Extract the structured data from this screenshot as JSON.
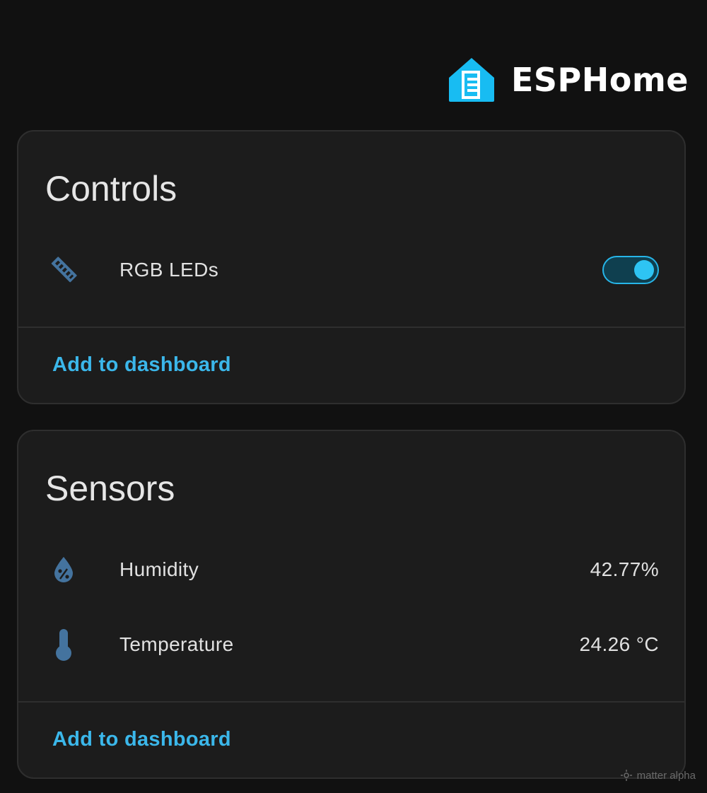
{
  "header": {
    "brand_name": "ESPHome",
    "logo_icon": "esphome-house-logo",
    "logo_color": "#18bcf2"
  },
  "controls": {
    "title": "Controls",
    "items": [
      {
        "icon": "led-strip-icon",
        "label": "RGB LEDs",
        "toggle_on": true
      }
    ],
    "action_label": "Add to dashboard"
  },
  "sensors": {
    "title": "Sensors",
    "items": [
      {
        "icon": "water-percent-icon",
        "label": "Humidity",
        "value": "42.77%"
      },
      {
        "icon": "thermometer-icon",
        "label": "Temperature",
        "value": "24.26 °C"
      }
    ],
    "action_label": "Add to dashboard"
  },
  "watermark": {
    "text": "matter alpha"
  },
  "colors": {
    "accent": "#3bb7ea",
    "icon": "#44739e",
    "background": "#111111",
    "card": "#1c1c1c"
  }
}
